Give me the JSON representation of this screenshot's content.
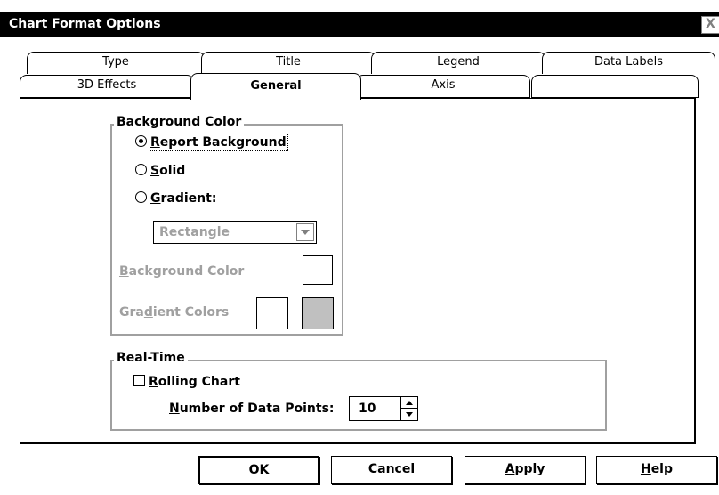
{
  "window": {
    "title": "Chart Format Options",
    "close_glyph": "X"
  },
  "tabs": {
    "back_row": [
      "Type",
      "Title",
      "Legend",
      "Data Labels"
    ],
    "front_row": [
      "3D Effects",
      "General",
      "Axis"
    ],
    "active": "General"
  },
  "background_color_group": {
    "label": "Background Color",
    "options": [
      {
        "label": "Report Background",
        "mnemonic": "R",
        "rest": "eport Background",
        "selected": true
      },
      {
        "label": "Solid",
        "mnemonic": "S",
        "rest": "olid",
        "selected": false
      },
      {
        "label": "Gradient:",
        "mnemonic": "G",
        "rest": "radient:",
        "selected": false
      }
    ],
    "gradient_style": {
      "value": "Rectangle"
    },
    "background_color_label": {
      "mnemonic": "B",
      "rest": "ackground Color"
    },
    "gradient_colors_label": {
      "pre": "Gra",
      "mnemonic": "d",
      "rest": "ient Colors"
    },
    "swatch_colors": {
      "background": "#ffffff",
      "gradient_1": "#ffffff",
      "gradient_2": "#c0c0c0"
    }
  },
  "realtime_group": {
    "label": "Real-Time",
    "rolling_chart": {
      "mnemonic": "R",
      "rest": "olling Chart",
      "checked": false
    },
    "data_points_label": {
      "mnemonic": "N",
      "rest": "umber of Data Points:"
    },
    "data_points_value": "10"
  },
  "buttons": {
    "ok": "OK",
    "cancel": "Cancel",
    "apply": {
      "mnemonic": "A",
      "rest": "pply"
    },
    "help": {
      "mnemonic": "H",
      "rest": "elp"
    }
  }
}
